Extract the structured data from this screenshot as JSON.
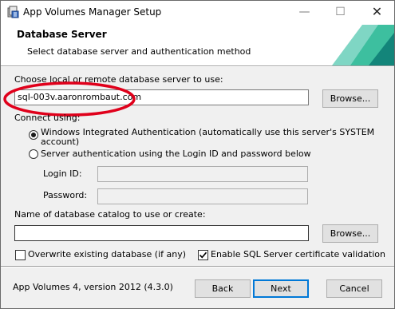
{
  "window": {
    "title": "App Volumes Manager Setup",
    "minimize_glyph": "—",
    "maximize_glyph": "☐",
    "close_glyph": "✕"
  },
  "banner": {
    "title": "Database Server",
    "subtitle": "Select database server and authentication method"
  },
  "server": {
    "label": "Choose local or remote database server to use:",
    "value": "sql-003v.aaronrombaut.com",
    "browse_label": "Browse..."
  },
  "connect": {
    "label": "Connect using:",
    "option_windows": "Windows Integrated Authentication (automatically use this server's SYSTEM",
    "option_windows_cont": "account)",
    "option_server": "Server authentication using the Login ID and password below",
    "selected": "windows"
  },
  "login": {
    "login_id_label": "Login ID:",
    "login_id_value": "",
    "password_label": "Password:",
    "password_value": ""
  },
  "catalog": {
    "label": "Name of database catalog to use or create:",
    "value": "",
    "browse_label": "Browse..."
  },
  "options": {
    "overwrite_label": "Overwrite existing database (if any)",
    "overwrite_checked": false,
    "ssl_label": "Enable SQL Server certificate validation",
    "ssl_checked": true
  },
  "footer": {
    "version": "App Volumes 4, version 2012 (4.3.0)",
    "back_label": "Back",
    "next_label": "Next",
    "cancel_label": "Cancel"
  },
  "colors": {
    "banner_teal_light": "#7fd6c4",
    "banner_teal_mid": "#3dbf9f",
    "banner_teal_dark": "#13857a",
    "annotation_red": "#e0001b"
  },
  "icons": {
    "app": "installer-package-icon"
  }
}
